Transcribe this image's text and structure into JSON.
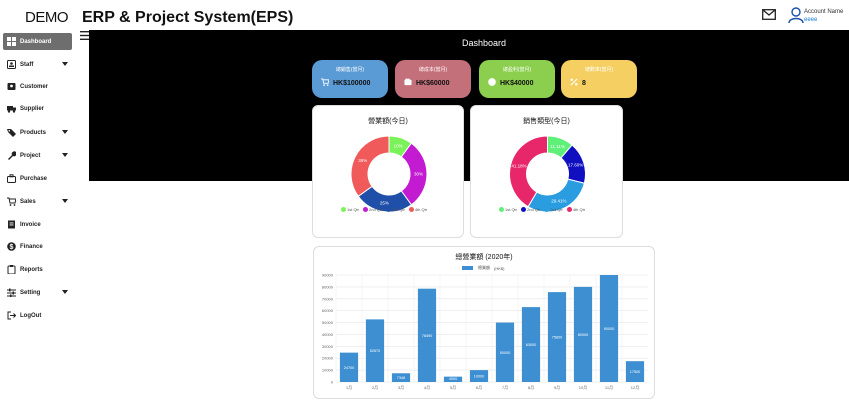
{
  "header": {
    "logo": "DEMO",
    "title": "ERP & Project System(EPS)",
    "account_label": "Account Name",
    "account_name": "eeee"
  },
  "sidebar": {
    "items": [
      {
        "label": "Dashboard",
        "icon": "dashboard-icon",
        "active": true,
        "caret": false
      },
      {
        "label": "Staff",
        "icon": "id-badge-icon",
        "active": false,
        "caret": true
      },
      {
        "label": "Customer",
        "icon": "contact-card-icon",
        "active": false,
        "caret": false
      },
      {
        "label": "Supplier",
        "icon": "truck-icon",
        "active": false,
        "caret": false
      },
      {
        "label": "Products",
        "icon": "tag-icon",
        "active": false,
        "caret": true
      },
      {
        "label": "Project",
        "icon": "wrench-icon",
        "active": false,
        "caret": true
      },
      {
        "label": "Purchase",
        "icon": "briefcase-icon",
        "active": false,
        "caret": false
      },
      {
        "label": "Sales",
        "icon": "cart-icon",
        "active": false,
        "caret": true
      },
      {
        "label": "Invoice",
        "icon": "invoice-icon",
        "active": false,
        "caret": false
      },
      {
        "label": "Finance",
        "icon": "dollar-icon",
        "active": false,
        "caret": false
      },
      {
        "label": "Reports",
        "icon": "clipboard-icon",
        "active": false,
        "caret": false
      },
      {
        "label": "Setting",
        "icon": "sliders-icon",
        "active": false,
        "caret": true
      },
      {
        "label": "LogOut",
        "icon": "logout-icon",
        "active": false,
        "caret": false
      }
    ]
  },
  "dashboard": {
    "title": "Dashboard"
  },
  "stats": [
    {
      "label": "總銷售(當月)",
      "value": "HK$100000",
      "color": "#5b9bd5",
      "icon": "cart-icon"
    },
    {
      "label": "總成本(當月)",
      "value": "HK$60000",
      "color": "#c4707a",
      "icon": "wallet-icon"
    },
    {
      "label": "總盈利(當月)",
      "value": "HK$40000",
      "color": "#8ccf4f",
      "icon": "dollar-icon"
    },
    {
      "label": "總數率(當月)",
      "value": "8",
      "color": "#f5cf62",
      "icon": "percent-icon"
    }
  ],
  "charts": {
    "legend_title": "總業額",
    "legend_title_unit": "(HK$)"
  },
  "chart_data": [
    {
      "type": "pie",
      "title": "營業額(今日)",
      "categories": [
        "1st Qtr",
        "2nd Qtr",
        "3rd Qtr",
        "4th Qtr"
      ],
      "values": [
        10,
        30,
        25,
        35
      ],
      "labels": [
        "10%",
        "30%",
        "25%",
        "35%"
      ],
      "colors": [
        "#7cf25a",
        "#c21bd1",
        "#1f4fa8",
        "#f05a5a"
      ]
    },
    {
      "type": "pie",
      "title": "銷售類型(今日)",
      "categories": [
        "1st Qtr",
        "2nd Qtr",
        "3rd Qtr",
        "4th Qtr"
      ],
      "values": [
        11.11,
        17.6,
        29.41,
        41.18
      ],
      "labels": [
        "11.11%",
        "17.60%",
        "29.41%",
        "41.18%"
      ],
      "colors": [
        "#5ff07a",
        "#1010c0",
        "#2a9de0",
        "#e8266a"
      ]
    },
    {
      "type": "bar",
      "title": "總營業額 (2020年)",
      "series_name": "總業額",
      "series_unit": "(HK$)",
      "categories": [
        "1月",
        "2月",
        "3月",
        "4月",
        "5月",
        "6月",
        "7月",
        "8月",
        "9月",
        "10月",
        "11月",
        "12月"
      ],
      "values": [
        24700,
        52670,
        7348,
        78490,
        4500,
        10000,
        50000,
        63000,
        75600,
        80000,
        90000,
        17500
      ],
      "labels": [
        "24700",
        "52670",
        "7348",
        "78490",
        "4500",
        "10000",
        "50000",
        "63000",
        "75600",
        "80000",
        "90000",
        "17500"
      ],
      "ylim": [
        0,
        90000
      ],
      "yticks": [
        0,
        10000,
        20000,
        30000,
        40000,
        50000,
        60000,
        70000,
        80000,
        90000
      ],
      "color": "#3d8fd1"
    }
  ]
}
